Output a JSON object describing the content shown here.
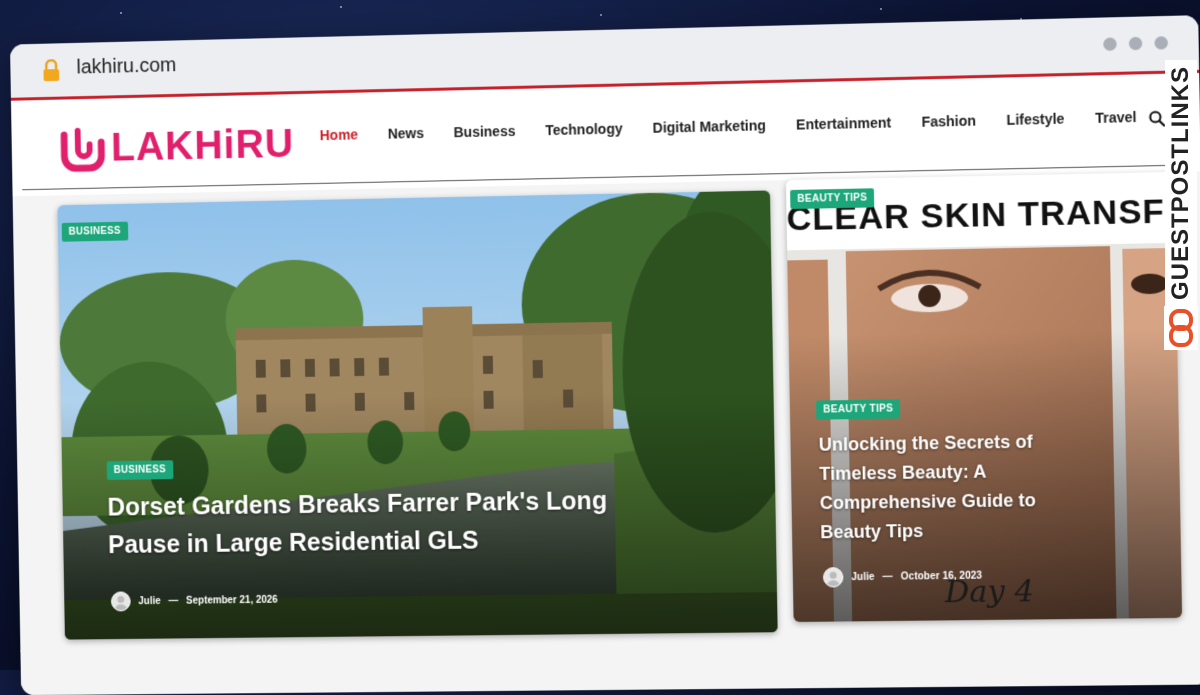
{
  "browser": {
    "url": "lakhiru.com"
  },
  "site": {
    "logo_text": "LAKHiRU",
    "nav": [
      "Home",
      "News",
      "Business",
      "Technology",
      "Digital Marketing",
      "Entertainment",
      "Fashion",
      "Lifestyle",
      "Travel"
    ],
    "active_nav": "Home"
  },
  "featured": {
    "category_top": "BUSINESS",
    "category": "BUSINESS",
    "title_line1": "Dorset Gardens Breaks Farrer Park's Long",
    "title_line2": "Pause in Large Residential GLS",
    "author": "Julie",
    "date": "September 21, 2026"
  },
  "side": {
    "category_top": "BEAUTY TIPS",
    "banner_text": "CLEAR SKIN TRANSFOR",
    "category": "BEAUTY TIPS",
    "title_lines": [
      "Unlocking the Secrets of",
      "Timeless Beauty: A",
      "Comprehensive Guide to",
      "Beauty Tips"
    ],
    "author": "Julie",
    "date": "October 16, 2023",
    "caption": "Day 4"
  },
  "watermark": {
    "text": "GUESTPOSTLINKS"
  },
  "colors": {
    "accent": "#e0206c",
    "nav_active": "#d0202a",
    "pill": "#1ca67a",
    "chrome_line": "#c8202a"
  }
}
